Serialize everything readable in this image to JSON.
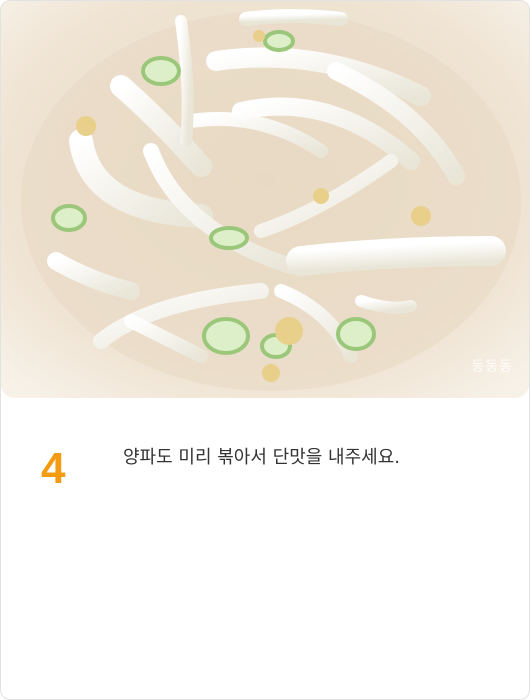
{
  "step": {
    "number": "4",
    "instruction": "양파도 미리 볶아서 단맛을 내주세요."
  },
  "photo": {
    "watermark": "동동동",
    "subject": "sliced onion and green onion in pan"
  },
  "colors": {
    "accent": "#f39c12",
    "text": "#333333",
    "pan": "#efe5d6"
  }
}
